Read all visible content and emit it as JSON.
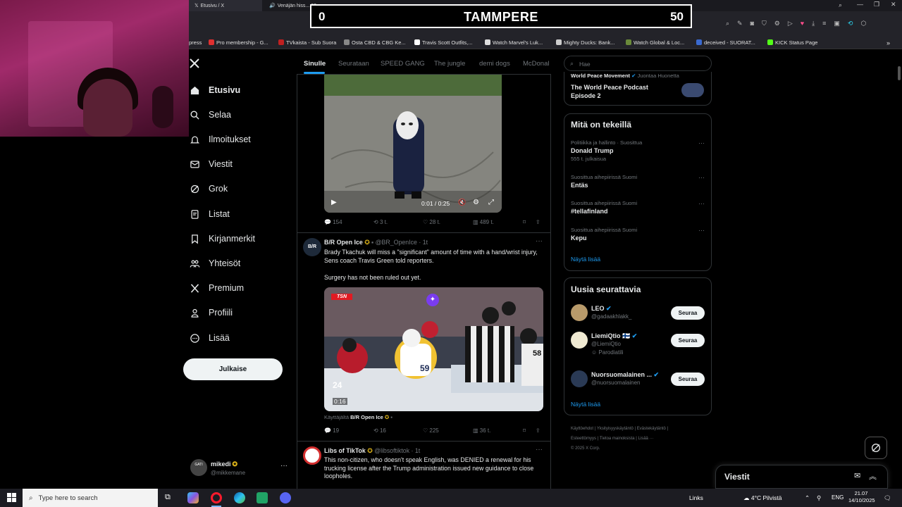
{
  "browser": {
    "tabs": [
      {
        "label": "Etusivu / X"
      },
      {
        "label": "Venäjän hiss... 30"
      }
    ],
    "bookmarks": [
      {
        "label": "press",
        "color": "#cccccc"
      },
      {
        "label": "Pro membership - G...",
        "color": "#e03030"
      },
      {
        "label": "TVkaista - Sub Suora",
        "color": "#c02020"
      },
      {
        "label": "Osta CBD & CBG Ke...",
        "color": "#888888"
      },
      {
        "label": "Travis Scott Outfits,...",
        "color": "#ffffff"
      },
      {
        "label": "Watch Marvel's Luk...",
        "color": "#dddddd"
      },
      {
        "label": "Mighty Ducks: Bank...",
        "color": "#cccccc"
      },
      {
        "label": "Watch Global & Loc...",
        "color": "#6a8a3a"
      },
      {
        "label": "deceived - SUORAT...",
        "color": "#3a6ad0"
      },
      {
        "label": "KICK Status Page",
        "color": "#53fc18"
      }
    ]
  },
  "scoreboard": {
    "left": "0",
    "center": "TAMMPERE",
    "right": "50"
  },
  "nav": {
    "items": [
      {
        "label": "Etusivu",
        "icon": "home-icon",
        "active": true
      },
      {
        "label": "Selaa",
        "icon": "search-icon"
      },
      {
        "label": "Ilmoitukset",
        "icon": "bell-icon"
      },
      {
        "label": "Viestit",
        "icon": "mail-icon"
      },
      {
        "label": "Grok",
        "icon": "grok-icon"
      },
      {
        "label": "Listat",
        "icon": "list-icon"
      },
      {
        "label": "Kirjanmerkit",
        "icon": "bookmark-icon"
      },
      {
        "label": "Yhteisöt",
        "icon": "communities-icon"
      },
      {
        "label": "Premium",
        "icon": "x-icon"
      },
      {
        "label": "Profiili",
        "icon": "person-icon"
      },
      {
        "label": "Lisää",
        "icon": "more-circle-icon"
      }
    ],
    "post_button": "Julkaise",
    "profile": {
      "name": "mikedi",
      "handle": "@mikkemane",
      "avatar_text": "GATI"
    }
  },
  "feed": {
    "tabs": [
      "Sinulle",
      "Seurataan",
      "SPEED GANG",
      "The jungle",
      "demi dogs",
      "McDonal"
    ],
    "tweet1": {
      "video_time": "0:01 / 0:25",
      "replies": "154",
      "retweets": "3 t.",
      "likes": "28 t.",
      "views": "489 t."
    },
    "tweet2": {
      "name": "B/R Open Ice",
      "handle": "@BR_OpenIce · 1t",
      "avatar_text": "B/R",
      "text1": "Brady Tkachuk will miss a \"significant\" amount of time with a hand/wrist injury, Sens coach Travis Green told reporters.",
      "text2": "Surgery has not been ruled out yet.",
      "video_time": "0:16",
      "video_brand": "TSN",
      "jersey_number": "59",
      "jersey_number2": "24",
      "jersey_number3": "58",
      "from_prefix": "Käyttäjältä",
      "from_user": "B/R Open Ice",
      "replies": "19",
      "retweets": "16",
      "likes": "225",
      "views": "36 t."
    },
    "tweet3": {
      "name": "Libs of TikTok",
      "handle": "@libsoftiktok · 1t",
      "text": "This non-citizen, who doesn't speak English, was DENIED a renewal for his trucking license after the Trump administration issued new guidance to close loopholes."
    }
  },
  "right": {
    "search_placeholder": "Hae",
    "podcast": {
      "source": "World Peace Movement",
      "joined": "Juontaa Huonetta",
      "title1": "The World Peace Podcast",
      "title2": "Episode 2"
    },
    "trending_title": "Mitä on tekeillä",
    "trends": [
      {
        "context": "Politiikka ja hallinto · Suosittua",
        "name": "Donald Trump",
        "count": "555 t. julkaisua"
      },
      {
        "context": "Suosittua aihepiirissä Suomi",
        "name": "Entäs",
        "count": ""
      },
      {
        "context": "Suosittua aihepiirissä Suomi",
        "name": "#tellafinland",
        "count": ""
      },
      {
        "context": "Suosittua aihepiirissä Suomi",
        "name": "Kepu",
        "count": ""
      }
    ],
    "show_more": "Näytä lisää",
    "who_to_follow_title": "Uusia seurattavia",
    "follow": [
      {
        "name": "LEO",
        "handle": "@gadaakhlakk_",
        "extra": "",
        "button": "Seuraa"
      },
      {
        "name": "LiemiQtio 🇫🇮",
        "handle": "@LiemiQtio",
        "extra": "Parodiatili",
        "button": "Seuraa"
      },
      {
        "name": "Nuorsuomalainen ...",
        "handle": "@nuorsuomalainen",
        "extra": "",
        "button": "Seuraa"
      }
    ],
    "show_more2": "Näytä lisää",
    "footer": {
      "line1": [
        "Käyttöehdot",
        "Yksityisyyskäytäntö",
        "Evästekäytäntö"
      ],
      "line2": [
        "Esteettömyys",
        "Tietoa mainoksista",
        "Lisää ···"
      ],
      "copyright": "© 2025 X Corp."
    },
    "messages": "Viestit"
  },
  "taskbar": {
    "search_placeholder": "Type here to search",
    "links": "Links",
    "weather": "4°C  Pilvistä",
    "lang": "ENG",
    "time": "21.07",
    "date": "14/10/2025"
  },
  "colors": {
    "accent": "#1d9bf0",
    "verified": "#1d9bf0",
    "gold": "#e2b719"
  }
}
